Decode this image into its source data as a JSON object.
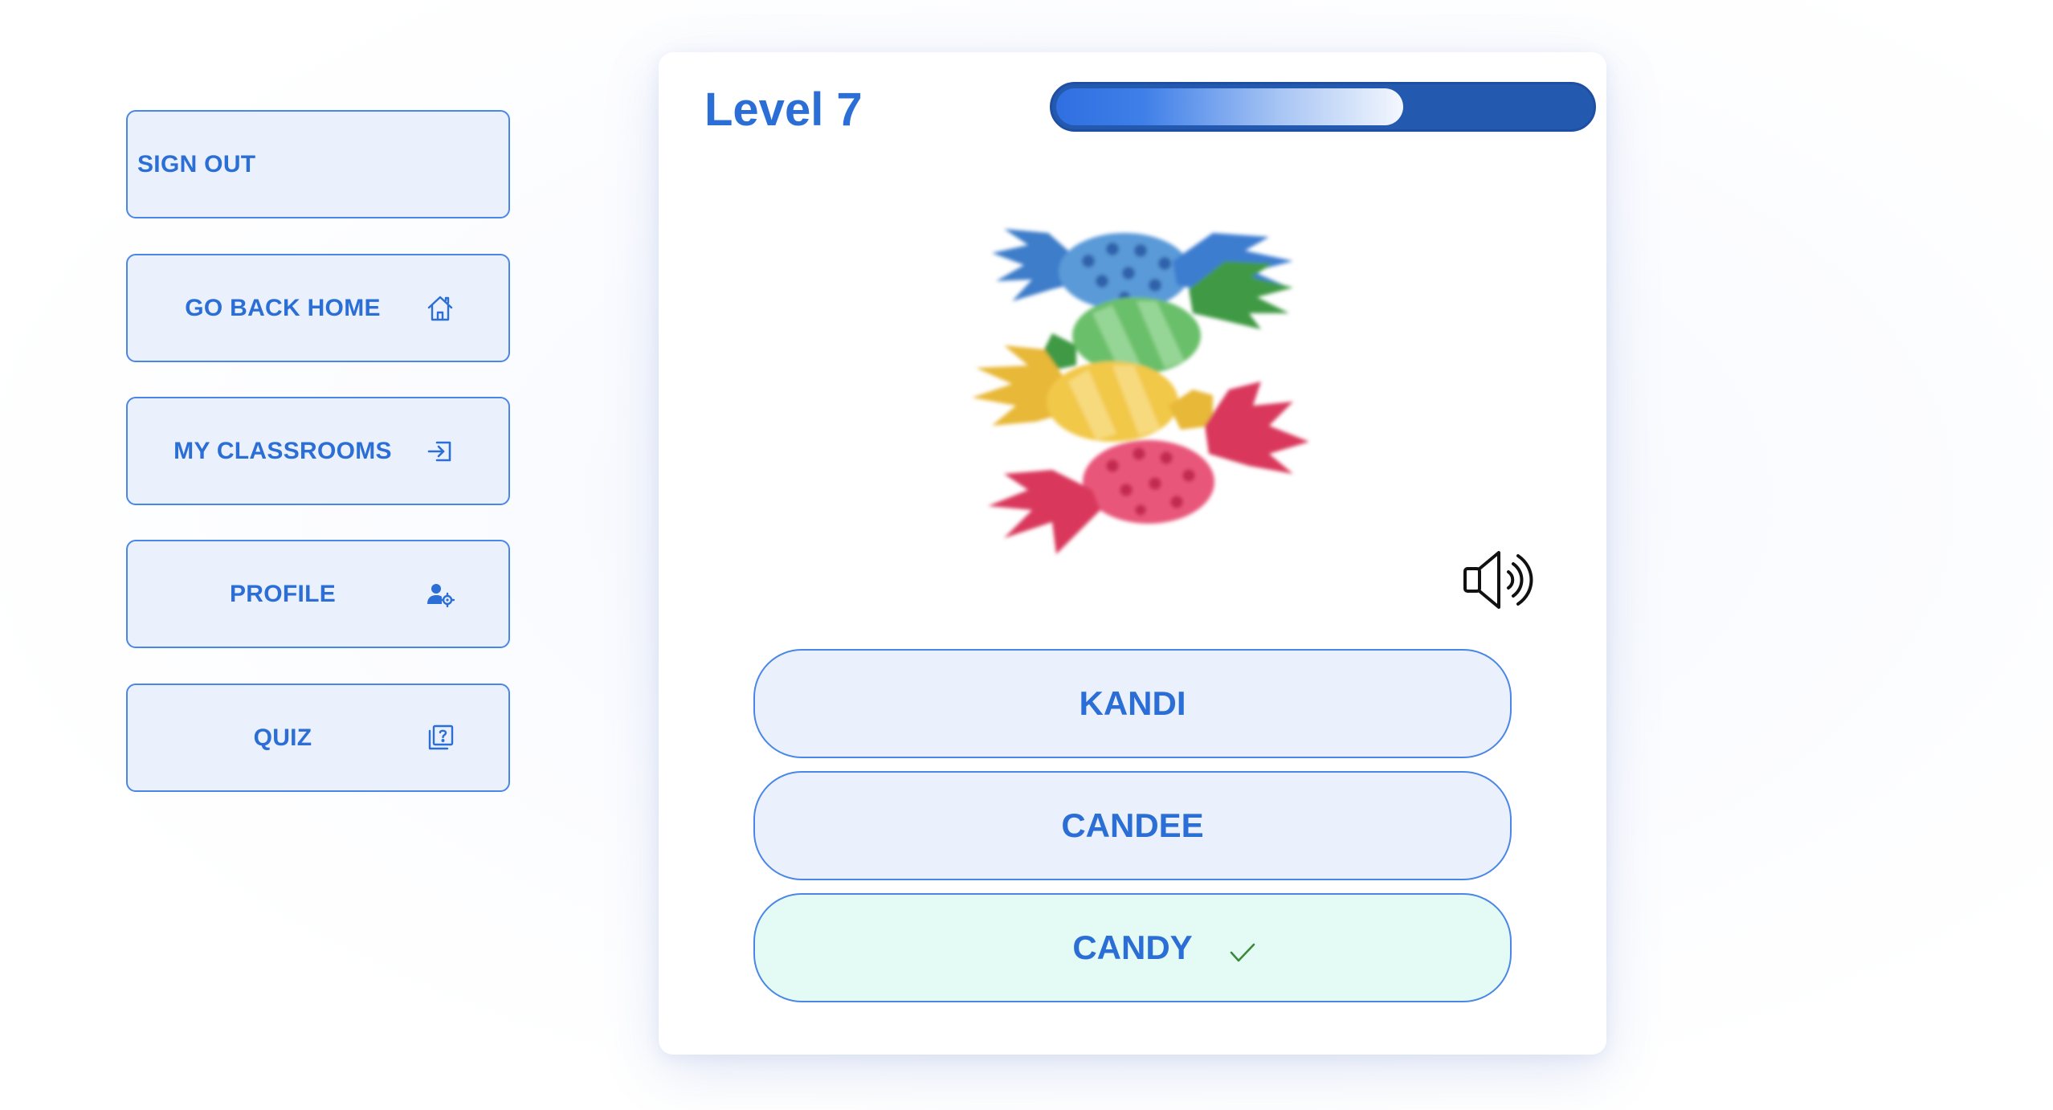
{
  "sidebar": {
    "items": [
      {
        "label": "SIGN OUT",
        "icon": "none"
      },
      {
        "label": "GO BACK HOME",
        "icon": "home-icon"
      },
      {
        "label": "MY CLASSROOMS",
        "icon": "sign-in-icon"
      },
      {
        "label": "PROFILE",
        "icon": "user-settings-icon"
      },
      {
        "label": "QUIZ",
        "icon": "quiz-icon"
      }
    ]
  },
  "quiz": {
    "level_title": "Level 7",
    "progress_fraction": 0.65,
    "image_subject": "wrapped candies",
    "audio_icon": "speaker-icon",
    "answers": [
      {
        "label": "KANDI",
        "state": "default"
      },
      {
        "label": "CANDEE",
        "state": "default"
      },
      {
        "label": "CANDY",
        "state": "correct",
        "mark_icon": "check-icon"
      }
    ]
  },
  "colors": {
    "accent": "#2b6fd6",
    "button_bg": "#ebf1fc",
    "button_border": "#4a86e8",
    "correct_bg": "#e4fbf5",
    "progress_track": "#2459b0",
    "check_mark": "#3a8a3a"
  }
}
